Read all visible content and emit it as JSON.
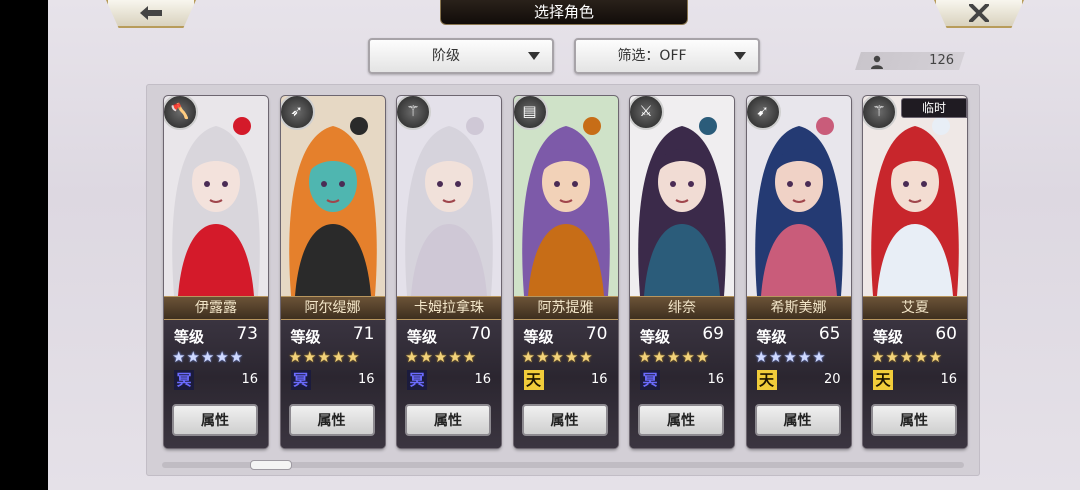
{
  "header": {
    "title": "选择角色"
  },
  "back_icon": "left-arrow-icon",
  "close_icon": "close-x-icon",
  "toolbar": {
    "sort_label": "阶级",
    "filter_label": "筛选：OFF",
    "character_count": "126"
  },
  "common": {
    "level_label": "等级",
    "attribute_button": "属性",
    "temp_badge": "临时"
  },
  "characters": [
    {
      "name": "伊露露",
      "level": "73",
      "stars": "★★★★★",
      "star_color": "silver",
      "rank_char": "冥",
      "rank_color": "blue",
      "rank_num": "16",
      "class_icon": "axe-icon",
      "temp": ""
    },
    {
      "name": "阿尔缇娜",
      "level": "71",
      "stars": "★★★★★",
      "star_color": "gold",
      "rank_char": "冥",
      "rank_color": "blue",
      "rank_num": "16",
      "class_icon": "bow-icon",
      "temp": ""
    },
    {
      "name": "卡姆拉拿珠",
      "level": "70",
      "stars": "★★★★★",
      "star_color": "gold",
      "rank_char": "冥",
      "rank_color": "blue",
      "rank_num": "16",
      "class_icon": "staff-icon",
      "temp": ""
    },
    {
      "name": "阿苏提雅",
      "level": "70",
      "stars": "★★★★★",
      "star_color": "gold",
      "rank_char": "天",
      "rank_color": "gold",
      "rank_num": "16",
      "class_icon": "book-icon",
      "temp": ""
    },
    {
      "name": "绯奈",
      "level": "69",
      "stars": "★★★★★",
      "star_color": "gold",
      "rank_char": "冥",
      "rank_color": "blue",
      "rank_num": "16",
      "class_icon": "sword-icon",
      "temp": ""
    },
    {
      "name": "希斯美娜",
      "level": "65",
      "stars": "★★★★★",
      "star_color": "silver",
      "rank_char": "天",
      "rank_color": "gold",
      "rank_num": "20",
      "class_icon": "spear-icon",
      "temp": ""
    },
    {
      "name": "艾夏",
      "level": "60",
      "stars": "★★★★★",
      "star_color": "gold",
      "rank_char": "天",
      "rank_color": "gold",
      "rank_num": "16",
      "class_icon": "staff-icon",
      "temp": "临时"
    }
  ],
  "portrait_colors": [
    {
      "bg": "#e9e6ea",
      "hair": "#d9d6dc",
      "skin": "#f3e2dc",
      "accent": "#d41a2a"
    },
    {
      "bg": "#e6d8c4",
      "hair": "#e5802c",
      "skin": "#4fb6b0",
      "accent": "#2a2a2a"
    },
    {
      "bg": "#e4e1ea",
      "hair": "#d6d3dc",
      "skin": "#f1e1da",
      "accent": "#cfc8d6"
    },
    {
      "bg": "#cfe2c8",
      "hair": "#7d5aa9",
      "skin": "#f2d2b8",
      "accent": "#c76d17"
    },
    {
      "bg": "#f0eef0",
      "hair": "#3b2a4a",
      "skin": "#f1dcd4",
      "accent": "#2b5c7a"
    },
    {
      "bg": "#e8e6ec",
      "hair": "#243a73",
      "skin": "#f0d2c6",
      "accent": "#c95c7a"
    },
    {
      "bg": "#efe8e6",
      "hair": "#c8262c",
      "skin": "#f3ddd2",
      "accent": "#e8eef6"
    }
  ]
}
